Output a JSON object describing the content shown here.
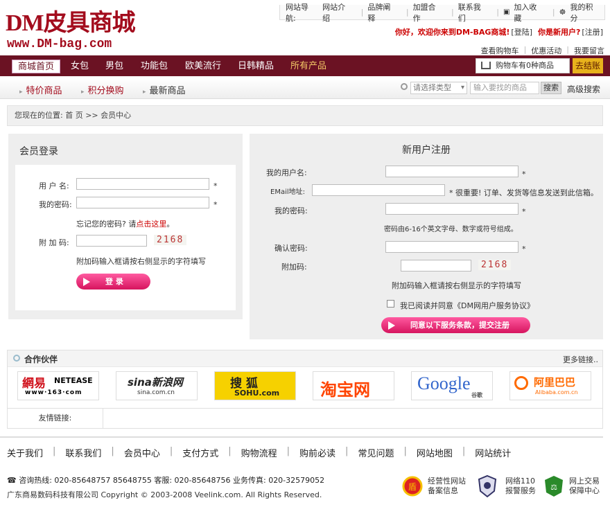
{
  "logo": {
    "cn": "DM皮具商城",
    "url": "www.DM-bag.com"
  },
  "topnav": {
    "label": "网站导航:",
    "items": [
      "网站介绍",
      "品牌阐释",
      "加盟合作",
      "联系我们",
      "加入收藏",
      "我的积分"
    ]
  },
  "greeting": {
    "hello": "你好，欢迎你来到DM-BAG商城!",
    "login": "[登陆]",
    "newuser": "你是新用户?",
    "register": "[注册]"
  },
  "links2": [
    "查看购物车",
    "优惠活动",
    "我要留言"
  ],
  "mainnav": {
    "items": [
      "商城首页",
      "女包",
      "男包",
      "功能包",
      "欧美流行",
      "日韩精品",
      "所有产品"
    ]
  },
  "cart": {
    "text": "购物车有0种商品",
    "checkout": "去结账"
  },
  "subnav": {
    "items": [
      "特价商品",
      "积分换购",
      "最新商品"
    ],
    "select_placeholder": "请选择类型",
    "search_placeholder": "输入要找的商品",
    "search_btn": "搜索",
    "advanced": "高级搜索"
  },
  "breadcrumb": "您现在的位置:  首 页  >>  会员中心",
  "login": {
    "title": "会员登录",
    "username_label": "用 户 名:",
    "password_label": "我的密码:",
    "forgot_text": "忘记您的密码? 请",
    "forgot_link": "点击这里",
    "forgot_end": "。",
    "captcha_label": "附 加 码:",
    "captcha": "2168",
    "captcha_hint": "附加码输入框请按右侧显示的字符填写",
    "button": "登  录",
    "star": "*"
  },
  "register": {
    "title": "新用户注册",
    "username_label": "我的用户名:",
    "email_label": "EMail地址:",
    "email_note": "* 很重要! 订单、发货等信息发送到此信箱。",
    "password_label": "我的密码:",
    "password_hint": "密码由6-16个英文字母、数字或符号组成。",
    "confirm_label": "确认密码:",
    "captcha_label": "附加码:",
    "captcha": "2168",
    "captcha_hint": "附加码输入框请按右侧显示的字符填写",
    "agree": "我已阅读并同意《DM网用户服务协议》",
    "button": "同意以下服务条款，提交注册",
    "star": "*"
  },
  "partners": {
    "title": "合作伙伴",
    "more": "更多链接..",
    "logos": [
      {
        "a": "網易",
        "b": "NETEASE",
        "c": "www·163·com"
      },
      {
        "a": "sina新浪网",
        "b": "sina.com.cn"
      },
      {
        "a": "搜  狐",
        "b": "SOHU.com"
      },
      {
        "a": "淘宝网"
      },
      {
        "a": "Google",
        "b": "谷歌"
      },
      {
        "a": "阿里巴巴",
        "b": "Alibaba.com.cn"
      }
    ]
  },
  "friend_links": "友情链接:",
  "footer": {
    "nav": [
      "关于我们",
      "联系我们",
      "会员中心",
      "支付方式",
      "购物流程",
      "购前必读",
      "常见问题",
      "网站地图",
      "网站统计"
    ],
    "tel": "☎ 咨询热线: 020-85648757 85648755 客服: 020-85648756 业务传真: 020-32579052",
    "copyright": "广东商易数码科技有限公司 Copyright © 2003-2008 Veelink.com. All Rights Reserved.",
    "badges": [
      {
        "l1": "经营性网站",
        "l2": "备案信息"
      },
      {
        "l1": "网络110",
        "l2": "报警服务"
      },
      {
        "l1": "网上交易",
        "l2": "保障中心"
      }
    ]
  },
  "colors": {
    "brand": "#6b1223",
    "logo": "#a30c1d",
    "checkout": "#e8b21c",
    "button_pink": "#e2206c"
  }
}
